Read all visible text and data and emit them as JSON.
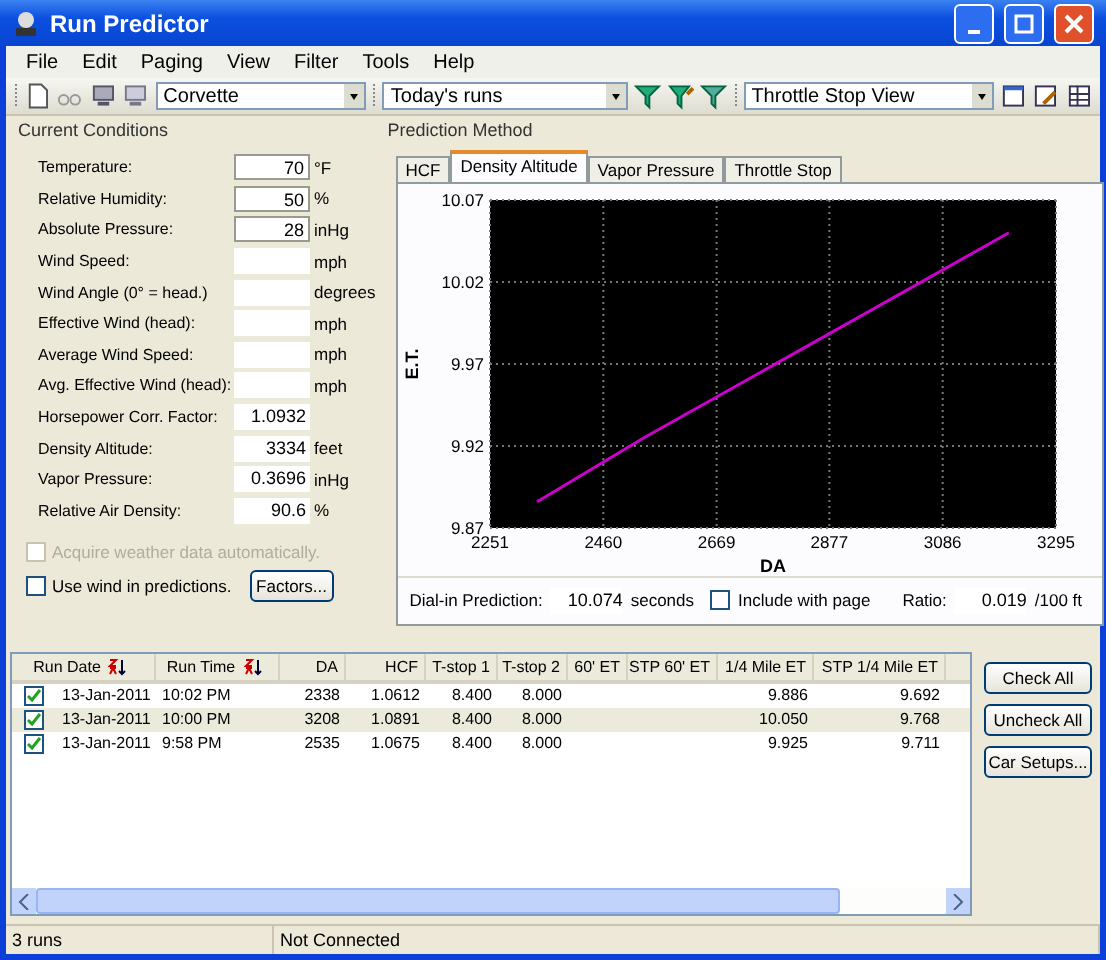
{
  "window": {
    "title": "Run Predictor"
  },
  "menu": [
    "File",
    "Edit",
    "Paging",
    "View",
    "Filter",
    "Tools",
    "Help"
  ],
  "toolbar": {
    "car": "Corvette",
    "filter": "Today's runs",
    "view": "Throttle Stop View"
  },
  "current_conditions": {
    "title": "Current Conditions",
    "fields": [
      {
        "label": "Temperature:",
        "value": "70",
        "unit": "°F",
        "editable": true
      },
      {
        "label": "Relative Humidity:",
        "value": "50",
        "unit": "%",
        "editable": true
      },
      {
        "label": "Absolute Pressure:",
        "value": "28",
        "unit": "inHg",
        "editable": true
      },
      {
        "label": "Wind Speed:",
        "unit": "mph",
        "editable": false
      },
      {
        "label": "Wind Angle (0° = head.)",
        "unit": "degrees",
        "editable": false
      },
      {
        "label": "Effective Wind (head):",
        "unit": "mph",
        "editable": false
      },
      {
        "label": "Average Wind Speed:",
        "unit": "mph",
        "editable": false
      },
      {
        "label": "Avg. Effective Wind (head):",
        "unit": "mph",
        "editable": false
      },
      {
        "label": "Horsepower Corr. Factor:",
        "value": "1.0932",
        "editable": false
      },
      {
        "label": "Density Altitude:",
        "value": "3334",
        "unit": "feet",
        "editable": false
      },
      {
        "label": "Vapor Pressure:",
        "value": "0.3696",
        "unit": "inHg",
        "editable": false
      },
      {
        "label": "Relative Air Density:",
        "value": "90.6",
        "unit": "%",
        "editable": false
      }
    ],
    "acquire": {
      "label": "Acquire weather data automatically.",
      "checked": false,
      "disabled": true
    },
    "use_wind": {
      "label": "Use wind in predictions.",
      "checked": false,
      "disabled": false
    },
    "factors_button": "Factors..."
  },
  "prediction_method": {
    "title": "Prediction Method",
    "tabs": [
      {
        "label": "HCF",
        "selected": false
      },
      {
        "label": "Density Altitude",
        "selected": true
      },
      {
        "label": "Vapor Pressure",
        "selected": false
      },
      {
        "label": "Throttle Stop",
        "selected": false
      }
    ],
    "chart_data": {
      "type": "line",
      "xlabel": "DA",
      "ylabel": "E.T.",
      "x": [
        2338,
        2535,
        3208
      ],
      "series": [
        {
          "color": "#cc00cc",
          "values": [
            9.886,
            9.925,
            10.05
          ]
        }
      ],
      "grid": true,
      "xlim": [
        2251,
        3295
      ],
      "ylim": [
        9.87,
        10.07
      ],
      "xticks": [
        2251,
        2460,
        2669,
        2877,
        3086,
        3295
      ],
      "yticks": [
        9.87,
        9.92,
        9.97,
        {
          "value": 10.02,
          "label": "10.02"
        },
        {
          "value": 10.07,
          "label": "10.07"
        }
      ]
    },
    "dial_in": {
      "label": "Dial-in Prediction:",
      "value": "10.074",
      "unit": "seconds"
    },
    "include": {
      "label": "Include with page",
      "checked": false
    },
    "ratio": {
      "label": "Ratio:",
      "value": "0.019",
      "unit": "/100 ft"
    }
  },
  "runs": {
    "columns": [
      {
        "label": "Run Date",
        "sortable": true
      },
      {
        "label": "Run Time",
        "sortable": true
      },
      {
        "label": "DA",
        "sortable": false
      },
      {
        "label": "HCF",
        "sortable": false
      },
      {
        "label": "T-stop 1",
        "sortable": false
      },
      {
        "label": "T-stop 2",
        "sortable": false
      },
      {
        "label": "60' ET",
        "sortable": false
      },
      {
        "label": "STP 60' ET",
        "sortable": false
      },
      {
        "label": "1/4 Mile ET",
        "sortable": false
      },
      {
        "label": "STP 1/4 Mile ET",
        "sortable": false
      }
    ],
    "rows": [
      {
        "checked": true,
        "selected": false,
        "cells": [
          "13-Jan-2011",
          "10:02 PM",
          "2338",
          "1.0612",
          "8.400",
          "8.000",
          "",
          "",
          "9.886",
          "9.692"
        ]
      },
      {
        "checked": true,
        "selected": true,
        "cells": [
          "13-Jan-2011",
          "10:00 PM",
          "3208",
          "1.0891",
          "8.400",
          "8.000",
          "",
          "",
          "10.050",
          "9.768"
        ]
      },
      {
        "checked": true,
        "selected": false,
        "cells": [
          "13-Jan-2011",
          "9:58 PM",
          "2535",
          "1.0675",
          "8.400",
          "8.000",
          "",
          "",
          "9.925",
          "9.711"
        ]
      }
    ]
  },
  "side_buttons": [
    "Check All",
    "Uncheck All",
    "Car Setups..."
  ],
  "status_bar": [
    "3 runs",
    "Not Connected"
  ]
}
